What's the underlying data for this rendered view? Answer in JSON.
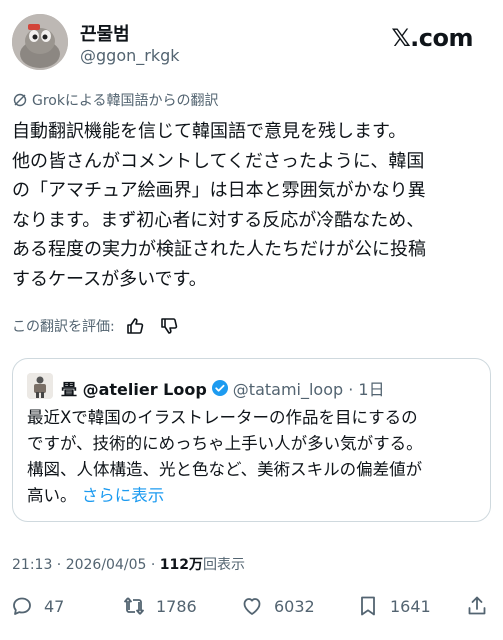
{
  "author": {
    "display_name": "끈물범",
    "handle": "@ggon_rkgk",
    "brand": "𝕏.com"
  },
  "translation_note": "Grokによる韓国語からの翻訳",
  "post": {
    "lines": [
      "自動翻訳機能を信じて韓国語で意見を残します。",
      "他の皆さんがコメントしてくださったように、韓国",
      "の「アマチュア絵画界」は日本と雰囲気がかなり異",
      "なります。まず初心者に対する反応が冷酷なため、",
      "ある程度の実力が検証された人たちだけが公に投稿",
      "するケースが多いです。"
    ]
  },
  "rate_translation": "この翻訳を評価:",
  "quote": {
    "name": "畳 @atelier Loop",
    "meta": "@tatami_loop · 1日",
    "lines": [
      "最近Xで韓国のイラストレーターの作品を目にするの",
      "ですが、技術的にめっちゃ上手い人が多い気がする。",
      "構図、人体構造、光と色など、美術スキルの偏差値が"
    ],
    "last_line": "高い。",
    "show_more": "さらに表示"
  },
  "timestamp": {
    "time": "21:13 · 2026/04/05 · ",
    "views": "112万",
    "views_label": "回表示"
  },
  "actions": {
    "replies": "47",
    "reposts": "1786",
    "likes": "6032",
    "bookmarks": "1641"
  },
  "colors": {
    "text": "#0f1419",
    "secondary": "#536471",
    "link": "#1d9bf0",
    "verified": "#1d9bf0",
    "border": "#cfd9de"
  }
}
